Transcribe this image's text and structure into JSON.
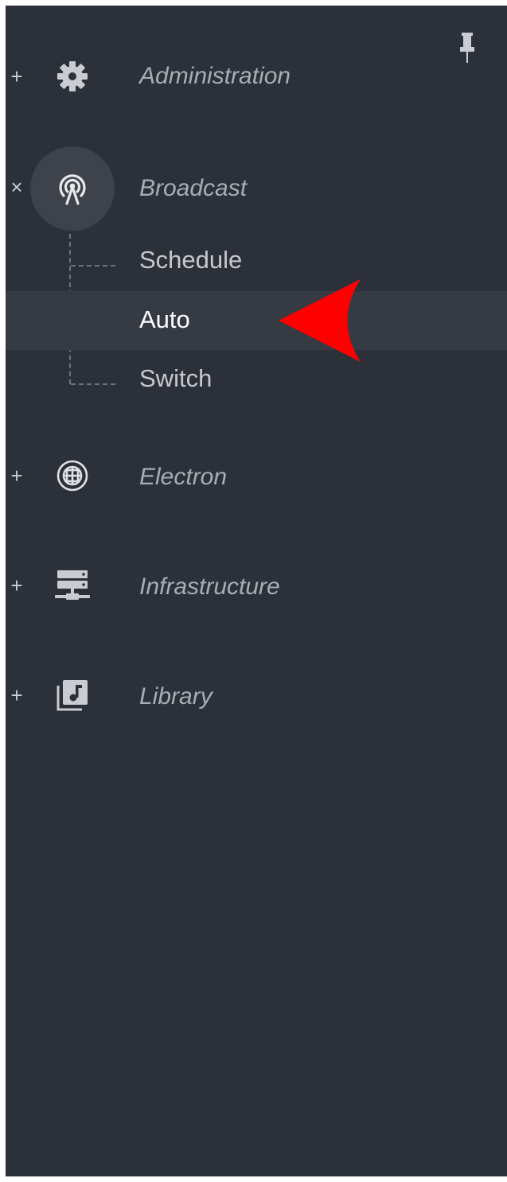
{
  "colors": {
    "sidebar_bg": "#2c3038",
    "active_row_bg": "#353a43",
    "active_icon_bg": "#3d424b",
    "label": "#a9adb4",
    "sub_label": "#c6c9ce",
    "sub_label_active": "#ffffff",
    "arrow": "#ff0000"
  },
  "pin": {
    "icon": "pin-icon"
  },
  "nav": {
    "items": [
      {
        "key": "administration",
        "label": "Administration",
        "toggle": "+",
        "icon": "gear-icon",
        "expanded": false
      },
      {
        "key": "broadcast",
        "label": "Broadcast",
        "toggle": "×",
        "icon": "broadcast-icon",
        "expanded": true,
        "children": [
          {
            "label": "Schedule",
            "active": false
          },
          {
            "label": "Auto",
            "active": true
          },
          {
            "label": "Switch",
            "active": false
          }
        ]
      },
      {
        "key": "electron",
        "label": "Electron",
        "toggle": "+",
        "icon": "globe-icon",
        "expanded": false
      },
      {
        "key": "infrastructure",
        "label": "Infrastructure",
        "toggle": "+",
        "icon": "server-icon",
        "expanded": false
      },
      {
        "key": "library",
        "label": "Library",
        "toggle": "+",
        "icon": "music-library-icon",
        "expanded": false
      }
    ]
  },
  "annotation": {
    "icon": "red-arrow-pointer"
  }
}
